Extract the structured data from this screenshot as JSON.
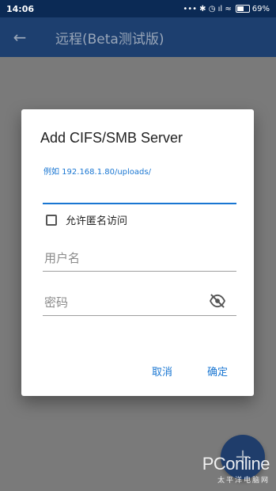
{
  "status_bar": {
    "time": "14:06",
    "signal_text": "••• ✱ ◷ ıl ≈",
    "battery_percent": 69,
    "battery_label": "69%"
  },
  "app_bar": {
    "title": "远程(Beta测试版)",
    "back_icon": "arrow-left-icon"
  },
  "dialog": {
    "title": "Add CIFS/SMB Server",
    "address_hint": "例如 192.168.1.80/uploads/",
    "address_value": "",
    "anonymous_label": "允许匿名访问",
    "anonymous_checked": false,
    "username_placeholder": "用户名",
    "password_placeholder": "密码",
    "visibility_icon": "eye-off-icon",
    "cancel_label": "取消",
    "confirm_label": "确定"
  },
  "fab": {
    "label": "+"
  },
  "watermark": {
    "main": "PConline",
    "sub": "太平洋电脑网"
  }
}
